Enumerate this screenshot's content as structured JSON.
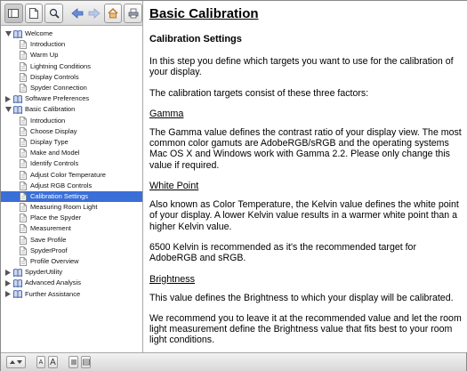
{
  "toolbar": {
    "buttons": [
      {
        "icon": "sidebar-toggle-icon"
      },
      {
        "icon": "contents-page-icon"
      },
      {
        "icon": "search-magnifier-icon"
      },
      {
        "icon": "back-arrow-icon"
      },
      {
        "icon": "forward-arrow-icon"
      },
      {
        "icon": "home-icon"
      },
      {
        "icon": "print-icon"
      }
    ]
  },
  "sidebar": {
    "groups": [
      {
        "label": "Welcome",
        "expanded": true,
        "children": [
          "Introduction",
          "Warm Up",
          "Lightning Conditions",
          "Display Controls",
          "Spyder Connection"
        ]
      },
      {
        "label": "Software Preferences",
        "expanded": false,
        "children": []
      },
      {
        "label": "Basic Calibration",
        "expanded": true,
        "children": [
          "Introduction",
          "Choose Display",
          "Display Type",
          "Make and Model",
          "Identify Controls",
          "Adjust Color Temperature",
          "Adjust RGB Controls",
          "Calibration Settings",
          "Measuring Room Light",
          "Place the Spyder",
          "Measurement",
          "Save Profile",
          "SpyderProof",
          "Profile Overview"
        ]
      },
      {
        "label": "SpyderUtility",
        "expanded": false,
        "children": []
      },
      {
        "label": "Advanced Analysis",
        "expanded": false,
        "children": []
      },
      {
        "label": "Further Assistance",
        "expanded": false,
        "children": []
      }
    ],
    "selected": "Calibration Settings"
  },
  "content": {
    "title": "Basic Calibration",
    "subtitle": "Calibration Settings",
    "intro1": "In this step you define which targets you want to use for the calibration of your display.",
    "intro2": "The calibration targets consist of these three factors:",
    "gamma_heading": "Gamma",
    "gamma_text": "The Gamma value defines the contrast ratio of your display view. The most common color gamuts are AdobeRGB/sRGB and the operating systems Mac OS X and Windows work with Gamma 2.2. Please only change this value if required.",
    "whitepoint_heading": "White Point",
    "whitepoint_text": "Also known as Color Temperature, the Kelvin value defines the white point of your display. A lower Kelvin value results in a warmer white point than a higher Kelvin value.",
    "whitepoint_text2": "6500 Kelvin is recommended as it's the recommended target for AdobeRGB and sRGB.",
    "brightness_heading": "Brightness",
    "brightness_text": "This value defines the Brightness to which your display will be calibrated.",
    "brightness_text2": "We recommend you to leave it at the recommended value and let the room light measurement define the Brightness value that fits best to your room light conditions."
  },
  "bottombar": {
    "font_small_label": "A",
    "font_large_label": "A"
  },
  "colors": {
    "selection": "#3a6fd8",
    "book_blue": "#3b5fa8"
  }
}
